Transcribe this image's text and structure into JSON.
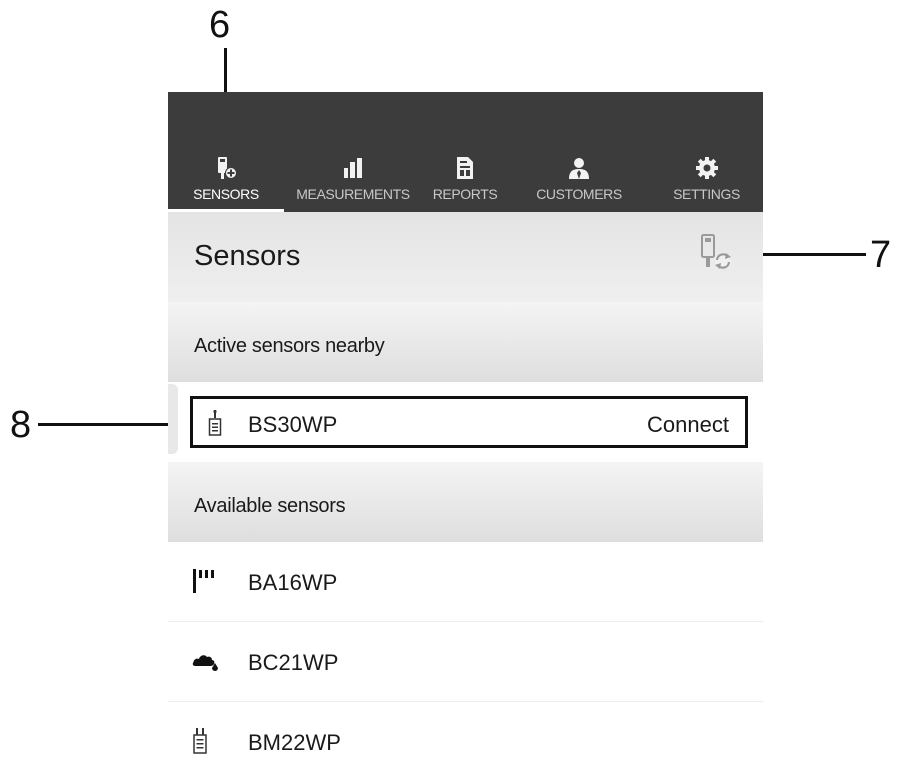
{
  "callouts": {
    "nav_sensors": "6",
    "refresh": "7",
    "active_row": "8"
  },
  "nav": {
    "tabs": [
      {
        "label": "SENSORS",
        "icon": "sensor-plus-icon",
        "active": true
      },
      {
        "label": "MEASUREMENTS",
        "icon": "bar-chart-icon",
        "active": false
      },
      {
        "label": "REPORTS",
        "icon": "report-icon",
        "active": false
      },
      {
        "label": "CUSTOMERS",
        "icon": "person-icon",
        "active": false
      },
      {
        "label": "SETTINGS",
        "icon": "gear-icon",
        "active": false
      }
    ]
  },
  "header": {
    "title": "Sensors",
    "refresh_icon": "sensor-refresh-icon"
  },
  "sections": {
    "active": {
      "title": "Active sensors nearby",
      "items": [
        {
          "name": "BS30WP",
          "action": "Connect",
          "icon": "probe-sensor-icon"
        }
      ]
    },
    "available": {
      "title": "Available sensors",
      "items": [
        {
          "name": "BA16WP",
          "icon": "signal-bars-icon"
        },
        {
          "name": "BC21WP",
          "icon": "cloud-drop-icon"
        },
        {
          "name": "BM22WP",
          "icon": "dual-probe-sensor-icon"
        }
      ]
    }
  },
  "colors": {
    "navbar": "#3c3c3c",
    "nav_active_text": "#ffffff",
    "nav_inactive_text": "#c8c8c8",
    "header_bg": "#e8e8e8"
  }
}
